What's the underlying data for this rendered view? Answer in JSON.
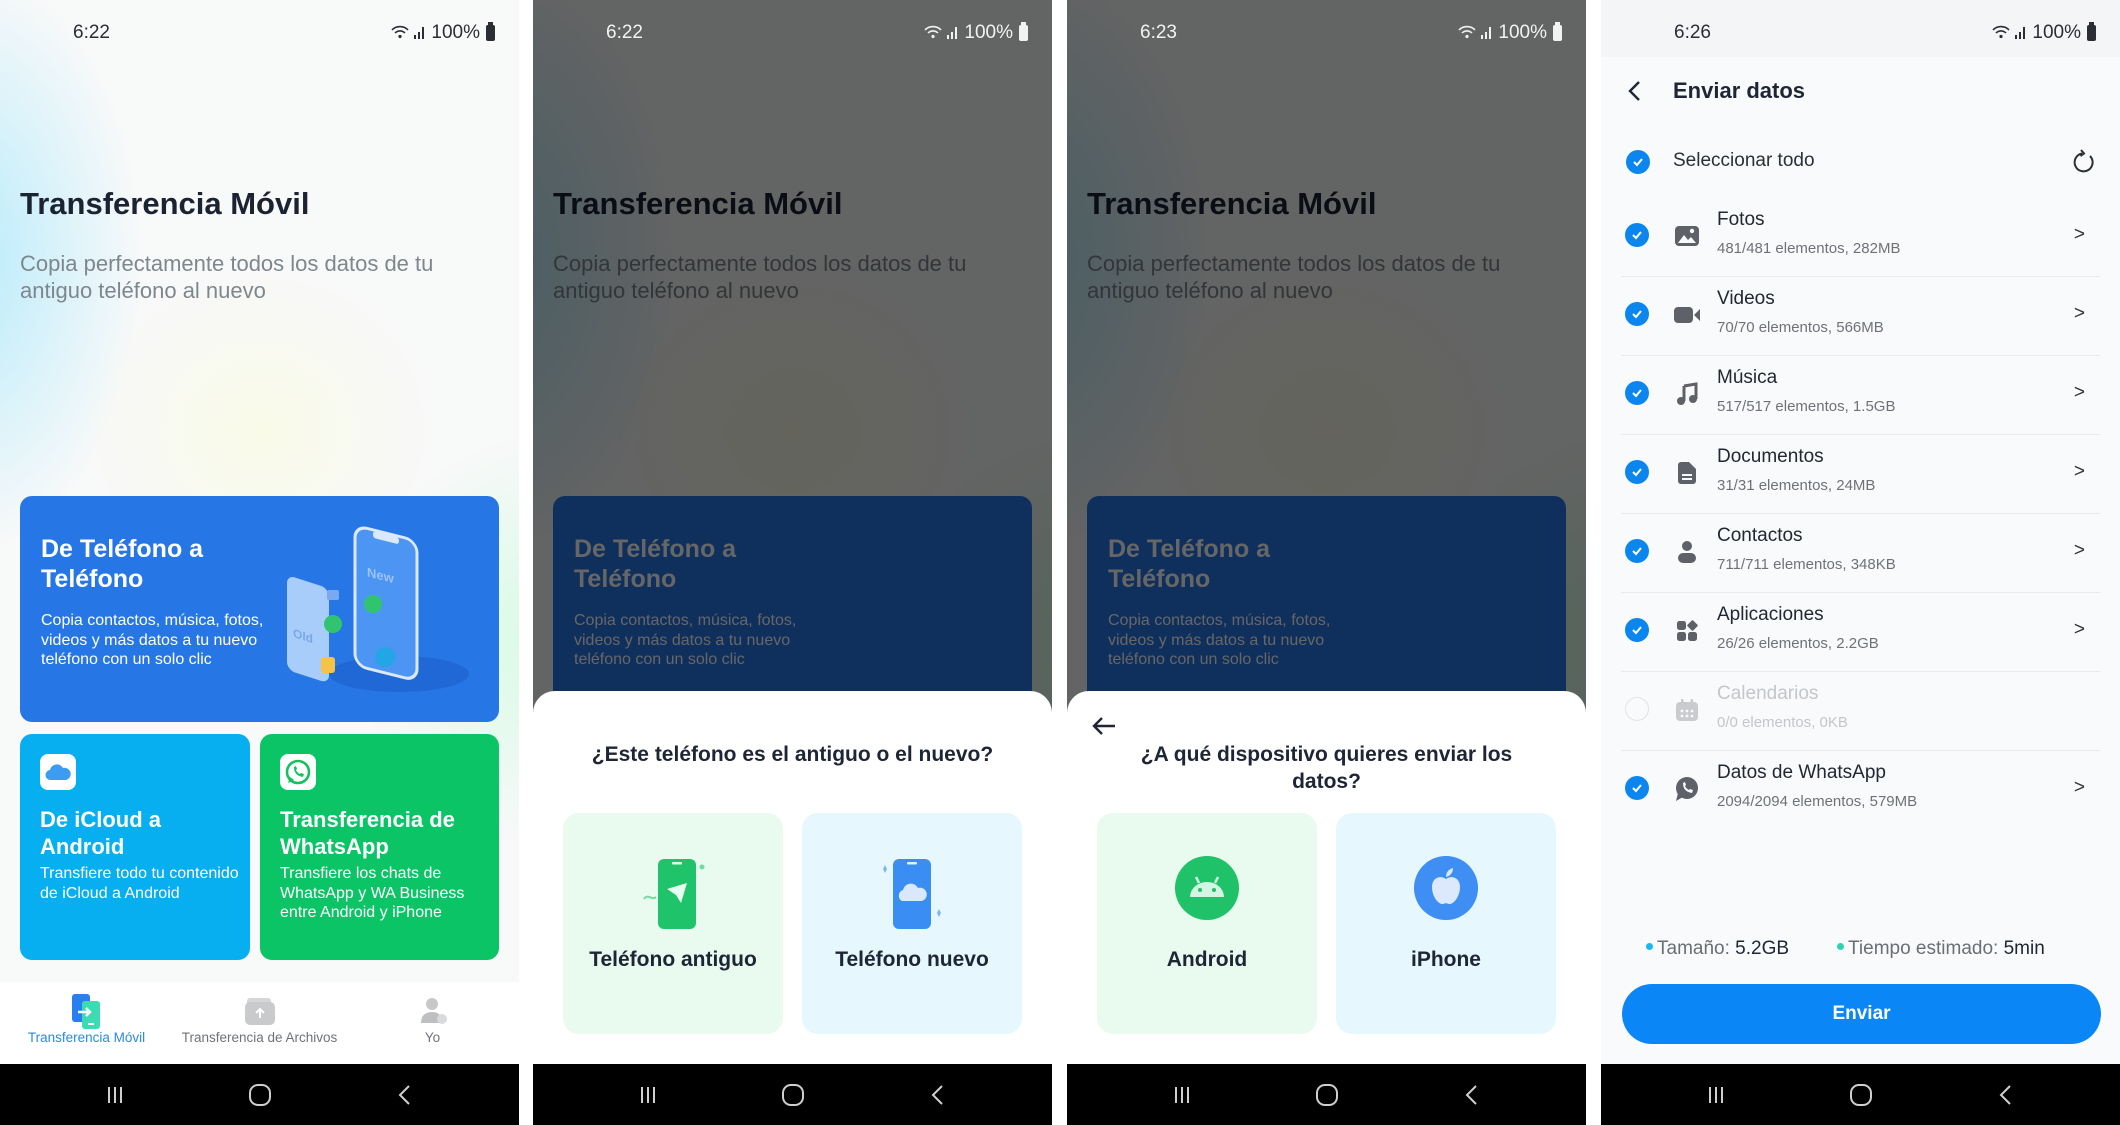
{
  "status": {
    "battery": "100%",
    "times": [
      "6:22",
      "6:22",
      "6:23",
      "6:26"
    ]
  },
  "home": {
    "title": "Transferencia Móvil",
    "subtitle": "Copia perfectamente todos los datos de tu antiguo teléfono al nuevo",
    "cards": {
      "phone_to_phone": {
        "title": "De Teléfono a Teléfono",
        "desc": "Copia contactos, música, fotos, videos y más datos a tu nuevo teléfono con un solo clic",
        "illus_old": "Old",
        "illus_new": "New"
      },
      "icloud": {
        "title": "De iCloud a Android",
        "desc": "Transfiere todo tu contenido de iCloud a Android"
      },
      "whatsapp": {
        "title": "Transferencia de WhatsApp",
        "desc": "Transfiere los chats de WhatsApp y WA Business entre Android y iPhone"
      }
    },
    "tabs": [
      {
        "label": "Transferencia Móvil",
        "icon": "phone-transfer-icon",
        "active": true
      },
      {
        "label": "Transferencia de Archivos",
        "icon": "folder-upload-icon",
        "active": false
      },
      {
        "label": "Yo",
        "icon": "user-icon",
        "active": false
      }
    ]
  },
  "sheet_role": {
    "title": "¿Este teléfono es el antiguo o el nuevo?",
    "options": [
      {
        "label": "Teléfono antiguo",
        "icon": "old-phone-send-icon"
      },
      {
        "label": "Teléfono nuevo",
        "icon": "new-phone-receive-icon"
      }
    ]
  },
  "sheet_device": {
    "title": "¿A qué dispositivo quieres enviar los datos?",
    "options": [
      {
        "label": "Android",
        "icon": "android-icon"
      },
      {
        "label": "iPhone",
        "icon": "apple-icon"
      }
    ]
  },
  "send": {
    "title": "Enviar datos",
    "select_all": "Seleccionar todo",
    "items": [
      {
        "name": "Fotos",
        "detail": "481/481 elementos, 282MB",
        "checked": true,
        "icon": "photo-icon"
      },
      {
        "name": "Videos",
        "detail": "70/70 elementos, 566MB",
        "checked": true,
        "icon": "video-icon"
      },
      {
        "name": "Música",
        "detail": "517/517 elementos, 1.5GB",
        "checked": true,
        "icon": "music-icon"
      },
      {
        "name": "Documentos",
        "detail": "31/31 elementos, 24MB",
        "checked": true,
        "icon": "document-icon"
      },
      {
        "name": "Contactos",
        "detail": "711/711 elementos, 348KB",
        "checked": true,
        "icon": "contact-icon"
      },
      {
        "name": "Aplicaciones",
        "detail": "26/26 elementos, 2.2GB",
        "checked": true,
        "icon": "apps-icon"
      },
      {
        "name": "Calendarios",
        "detail": "0/0 elementos, 0KB",
        "checked": false,
        "icon": "calendar-icon"
      },
      {
        "name": "Datos de WhatsApp",
        "detail": "2094/2094 elementos, 579MB",
        "checked": true,
        "icon": "whatsapp-icon"
      }
    ],
    "size_label": "Tamaño:",
    "size_value": "5.2GB",
    "time_label": "Tiempo estimado:",
    "time_value": "5min",
    "button": "Enviar"
  },
  "colors": {
    "primary_blue": "#0b86f7",
    "card_blue": "#2776e6",
    "icloud_blue": "#07aef0",
    "whatsapp_green": "#0bc466",
    "size_dot": "#1ab8f0",
    "time_dot": "#2fd3b0"
  }
}
